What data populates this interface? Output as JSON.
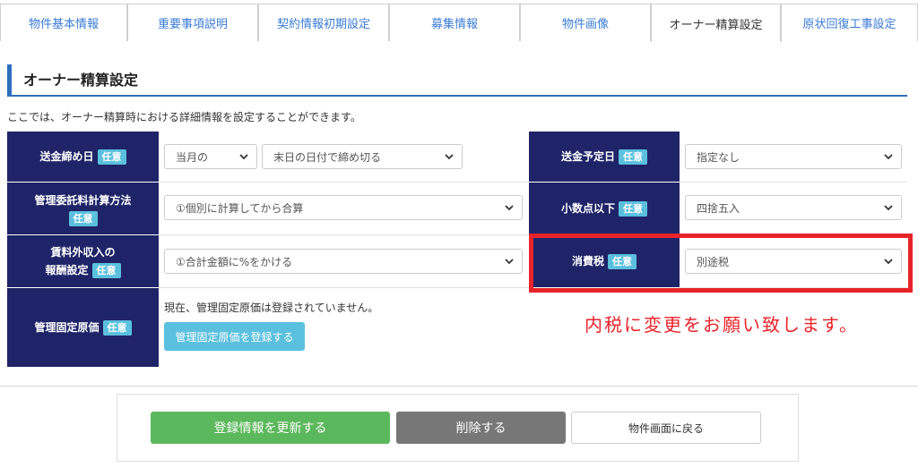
{
  "tabs": [
    {
      "label": "物件基本情報",
      "active": false
    },
    {
      "label": "重要事項説明",
      "active": false
    },
    {
      "label": "契約情報初期設定",
      "active": false
    },
    {
      "label": "募集情報",
      "active": false
    },
    {
      "label": "物件画像",
      "active": false
    },
    {
      "label": "オーナー精算設定",
      "active": true
    },
    {
      "label": "原状回復工事設定",
      "active": false
    }
  ],
  "section": {
    "title": "オーナー精算設定",
    "description": "ここでは、オーナー精算時における詳細情報を設定することができます。"
  },
  "badge": "任意",
  "fields": {
    "remit_cutoff": {
      "label": "送金締め日",
      "value1": "当月の",
      "value2": "末日の日付で締め切る"
    },
    "mgmt_fee_method": {
      "label": "管理委託料計算方法",
      "value": "①個別に計算してから合算"
    },
    "non_rent_income": {
      "label_line1": "賃料外収入の",
      "label_line2": "報酬設定",
      "value": "①合計金額に%をかける"
    },
    "mgmt_fixed_cost": {
      "label": "管理固定原価",
      "note": "現在、管理固定原価は登録されていません。",
      "button": "管理固定原価を登録する"
    },
    "remit_date": {
      "label": "送金予定日",
      "value": "指定なし"
    },
    "decimal": {
      "label": "小数点以下",
      "value": "四捨五入"
    },
    "tax": {
      "label": "消費税",
      "value": "別途税"
    }
  },
  "annotation": "内税に変更をお願い致します。",
  "buttons": {
    "update": "登録情報を更新する",
    "delete": "削除する",
    "back": "物件画面に戻る"
  },
  "colors": {
    "label_bg": "#1f2468",
    "badge_bg": "#5bc0de",
    "accent_blue": "#2e6fbd",
    "annotation_red": "#e8232a",
    "update_green": "#5cb85c",
    "delete_gray": "#777777"
  }
}
